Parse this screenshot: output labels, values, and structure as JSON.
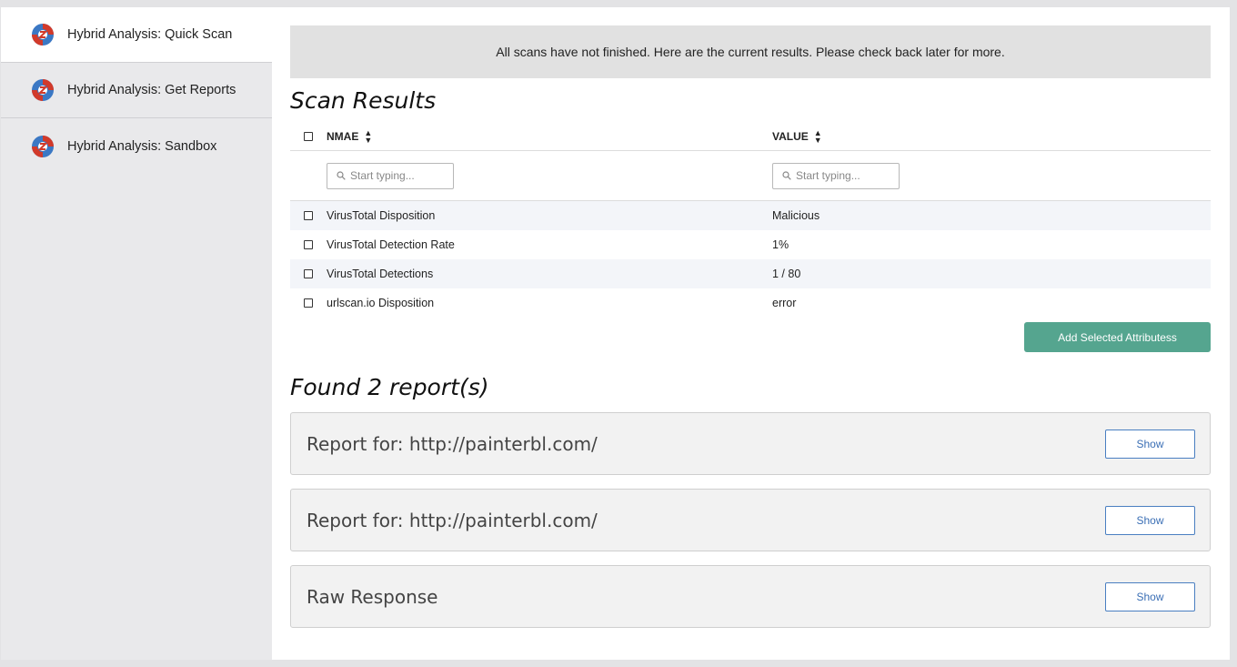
{
  "sidebar": {
    "items": [
      {
        "label": "Hybrid Analysis: Quick Scan",
        "active": true
      },
      {
        "label": "Hybrid Analysis: Get Reports",
        "active": false
      },
      {
        "label": "Hybrid Analysis: Sandbox",
        "active": false
      }
    ],
    "logo_colors": {
      "blue": "#3b78c4",
      "red": "#d23a2a"
    }
  },
  "banner": {
    "text": "All scans have not finished. Here are the current results. Please check back later for more."
  },
  "scan_results": {
    "title": "Scan Results",
    "columns": {
      "name": "NMAE",
      "value": "VALUE"
    },
    "filter_placeholder_name": "Start typing...",
    "filter_placeholder_value": "Start typing...",
    "rows": [
      {
        "name": "VirusTotal Disposition",
        "value": "Malicious"
      },
      {
        "name": "VirusTotal Detection Rate",
        "value": "1%"
      },
      {
        "name": "VirusTotal Detections",
        "value": "1 / 80"
      },
      {
        "name": "urlscan.io Disposition",
        "value": "error"
      }
    ],
    "add_button": "Add Selected Attributess"
  },
  "reports": {
    "title": "Found 2 report(s)",
    "items": [
      {
        "title": "Report for: http://painterbl.com/",
        "button": "Show"
      },
      {
        "title": "Report for: http://painterbl.com/",
        "button": "Show"
      },
      {
        "title": "Raw Response",
        "button": "Show"
      }
    ]
  },
  "colors": {
    "accent_green": "#55a58f",
    "show_blue": "#4a7fc1"
  }
}
